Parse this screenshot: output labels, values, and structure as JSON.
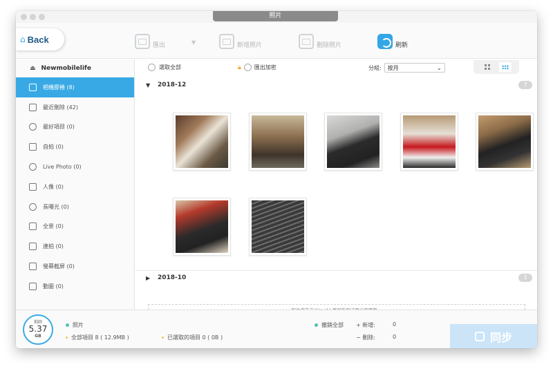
{
  "window": {
    "title": "照片"
  },
  "toolbar": {
    "back_label": "Back",
    "buttons": [
      {
        "label": "匯出",
        "icon": "export-icon"
      },
      {
        "label": "新增照片",
        "icon": "add-photo-icon"
      },
      {
        "label": "刪除照片",
        "icon": "delete-photo-icon"
      },
      {
        "label": "刷新",
        "icon": "refresh-icon"
      }
    ]
  },
  "sidebar": {
    "device": "Newmobilelife",
    "items": [
      {
        "label": "相機膠捲 (8)",
        "icon": "camera-icon"
      },
      {
        "label": "最近刪除 (42)",
        "icon": "trash-icon"
      },
      {
        "label": "最好項目 (0)",
        "icon": "heart-icon"
      },
      {
        "label": "自拍 (0)",
        "icon": "selfie-icon"
      },
      {
        "label": "Live Photo (0)",
        "icon": "live-photo-icon"
      },
      {
        "label": "人像 (0)",
        "icon": "portrait-cube-icon"
      },
      {
        "label": "長曝光 (0)",
        "icon": "long-exposure-icon"
      },
      {
        "label": "全景 (0)",
        "icon": "panorama-icon"
      },
      {
        "label": "連拍 (0)",
        "icon": "burst-icon"
      },
      {
        "label": "螢幕截屏 (0)",
        "icon": "screenshot-icon"
      },
      {
        "label": "動圖 (0)",
        "icon": "animated-icon"
      }
    ]
  },
  "main": {
    "select_all": "選取全部",
    "export_encrypt": "匯出加密",
    "group_label": "分組:",
    "group_value": "按月",
    "sections": [
      {
        "date": "2018-12",
        "count": "7"
      },
      {
        "date": "2018-10",
        "count": "1"
      }
    ],
    "icloud_note": "照片存在于iCloud上面可能無法匯出至電腦。"
  },
  "footer": {
    "storage_caption": "剩餘",
    "storage_value": "5.37",
    "storage_unit": "GB",
    "category": "照片",
    "total_items": "全部項目 8 ( 12.9MB )",
    "selected_items": "已選取的項目 0 ( 0B )",
    "undo_all": "撤銷全部",
    "added_label": "+ 新增:",
    "added_value": "0",
    "deleted_label": "− 刪除:",
    "deleted_value": "0",
    "sync_label": "同步"
  },
  "colors": {
    "accent": "#38a9e4",
    "category_dot": "#4fc2b5",
    "selected_dot": "#f2c744",
    "lock": "#e7a21f"
  }
}
